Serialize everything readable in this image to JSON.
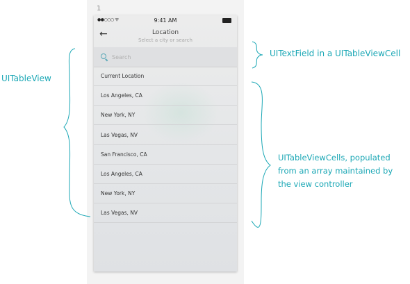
{
  "artboard": {
    "number": "1"
  },
  "status_bar": {
    "signal": "●●○○○",
    "wifi": "ᯤ",
    "time": "9:41 AM"
  },
  "nav": {
    "title": "Location",
    "subtitle": "Select a city or search",
    "back_icon": "arrow-left-icon"
  },
  "search": {
    "placeholder": "Search",
    "value": ""
  },
  "table": {
    "cells": [
      {
        "label": "Current Location"
      },
      {
        "label": "Los Angeles, CA"
      },
      {
        "label": "New York, NY"
      },
      {
        "label": "Las Vegas, NV"
      },
      {
        "label": "San Francisco, CA"
      },
      {
        "label": "Los Angeles, CA"
      },
      {
        "label": "New York, NY"
      },
      {
        "label": "Las Vegas, NV"
      }
    ]
  },
  "annotations": {
    "tableview": "UITableView",
    "textfield": "UITextField in a UITableViewCell",
    "cells_lines": [
      "UITableViewCells, populated",
      "from an array maintained by",
      "the view controller"
    ]
  },
  "colors": {
    "annotation": "#1aa7b5",
    "search_icon": "#5aa9b8"
  }
}
